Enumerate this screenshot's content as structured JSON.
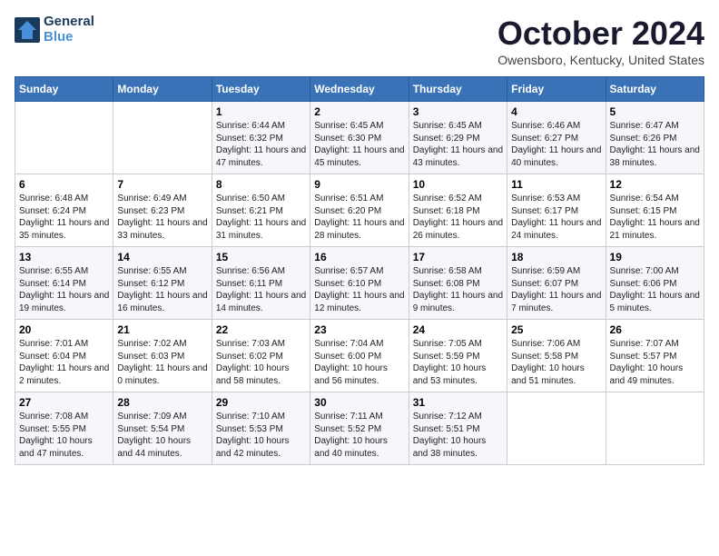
{
  "header": {
    "logo_line1": "General",
    "logo_line2": "Blue",
    "month_title": "October 2024",
    "subtitle": "Owensboro, Kentucky, United States"
  },
  "days_of_week": [
    "Sunday",
    "Monday",
    "Tuesday",
    "Wednesday",
    "Thursday",
    "Friday",
    "Saturday"
  ],
  "weeks": [
    [
      {
        "day": "",
        "info": ""
      },
      {
        "day": "",
        "info": ""
      },
      {
        "day": "1",
        "info": "Sunrise: 6:44 AM\nSunset: 6:32 PM\nDaylight: 11 hours and 47 minutes."
      },
      {
        "day": "2",
        "info": "Sunrise: 6:45 AM\nSunset: 6:30 PM\nDaylight: 11 hours and 45 minutes."
      },
      {
        "day": "3",
        "info": "Sunrise: 6:45 AM\nSunset: 6:29 PM\nDaylight: 11 hours and 43 minutes."
      },
      {
        "day": "4",
        "info": "Sunrise: 6:46 AM\nSunset: 6:27 PM\nDaylight: 11 hours and 40 minutes."
      },
      {
        "day": "5",
        "info": "Sunrise: 6:47 AM\nSunset: 6:26 PM\nDaylight: 11 hours and 38 minutes."
      }
    ],
    [
      {
        "day": "6",
        "info": "Sunrise: 6:48 AM\nSunset: 6:24 PM\nDaylight: 11 hours and 35 minutes."
      },
      {
        "day": "7",
        "info": "Sunrise: 6:49 AM\nSunset: 6:23 PM\nDaylight: 11 hours and 33 minutes."
      },
      {
        "day": "8",
        "info": "Sunrise: 6:50 AM\nSunset: 6:21 PM\nDaylight: 11 hours and 31 minutes."
      },
      {
        "day": "9",
        "info": "Sunrise: 6:51 AM\nSunset: 6:20 PM\nDaylight: 11 hours and 28 minutes."
      },
      {
        "day": "10",
        "info": "Sunrise: 6:52 AM\nSunset: 6:18 PM\nDaylight: 11 hours and 26 minutes."
      },
      {
        "day": "11",
        "info": "Sunrise: 6:53 AM\nSunset: 6:17 PM\nDaylight: 11 hours and 24 minutes."
      },
      {
        "day": "12",
        "info": "Sunrise: 6:54 AM\nSunset: 6:15 PM\nDaylight: 11 hours and 21 minutes."
      }
    ],
    [
      {
        "day": "13",
        "info": "Sunrise: 6:55 AM\nSunset: 6:14 PM\nDaylight: 11 hours and 19 minutes."
      },
      {
        "day": "14",
        "info": "Sunrise: 6:55 AM\nSunset: 6:12 PM\nDaylight: 11 hours and 16 minutes."
      },
      {
        "day": "15",
        "info": "Sunrise: 6:56 AM\nSunset: 6:11 PM\nDaylight: 11 hours and 14 minutes."
      },
      {
        "day": "16",
        "info": "Sunrise: 6:57 AM\nSunset: 6:10 PM\nDaylight: 11 hours and 12 minutes."
      },
      {
        "day": "17",
        "info": "Sunrise: 6:58 AM\nSunset: 6:08 PM\nDaylight: 11 hours and 9 minutes."
      },
      {
        "day": "18",
        "info": "Sunrise: 6:59 AM\nSunset: 6:07 PM\nDaylight: 11 hours and 7 minutes."
      },
      {
        "day": "19",
        "info": "Sunrise: 7:00 AM\nSunset: 6:06 PM\nDaylight: 11 hours and 5 minutes."
      }
    ],
    [
      {
        "day": "20",
        "info": "Sunrise: 7:01 AM\nSunset: 6:04 PM\nDaylight: 11 hours and 2 minutes."
      },
      {
        "day": "21",
        "info": "Sunrise: 7:02 AM\nSunset: 6:03 PM\nDaylight: 11 hours and 0 minutes."
      },
      {
        "day": "22",
        "info": "Sunrise: 7:03 AM\nSunset: 6:02 PM\nDaylight: 10 hours and 58 minutes."
      },
      {
        "day": "23",
        "info": "Sunrise: 7:04 AM\nSunset: 6:00 PM\nDaylight: 10 hours and 56 minutes."
      },
      {
        "day": "24",
        "info": "Sunrise: 7:05 AM\nSunset: 5:59 PM\nDaylight: 10 hours and 53 minutes."
      },
      {
        "day": "25",
        "info": "Sunrise: 7:06 AM\nSunset: 5:58 PM\nDaylight: 10 hours and 51 minutes."
      },
      {
        "day": "26",
        "info": "Sunrise: 7:07 AM\nSunset: 5:57 PM\nDaylight: 10 hours and 49 minutes."
      }
    ],
    [
      {
        "day": "27",
        "info": "Sunrise: 7:08 AM\nSunset: 5:55 PM\nDaylight: 10 hours and 47 minutes."
      },
      {
        "day": "28",
        "info": "Sunrise: 7:09 AM\nSunset: 5:54 PM\nDaylight: 10 hours and 44 minutes."
      },
      {
        "day": "29",
        "info": "Sunrise: 7:10 AM\nSunset: 5:53 PM\nDaylight: 10 hours and 42 minutes."
      },
      {
        "day": "30",
        "info": "Sunrise: 7:11 AM\nSunset: 5:52 PM\nDaylight: 10 hours and 40 minutes."
      },
      {
        "day": "31",
        "info": "Sunrise: 7:12 AM\nSunset: 5:51 PM\nDaylight: 10 hours and 38 minutes."
      },
      {
        "day": "",
        "info": ""
      },
      {
        "day": "",
        "info": ""
      }
    ]
  ]
}
